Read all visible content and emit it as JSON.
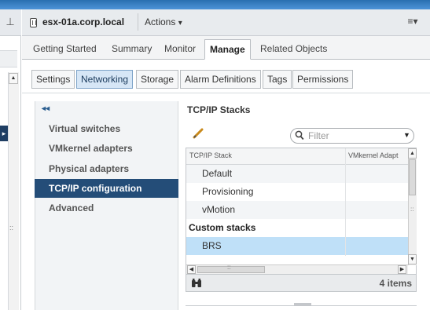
{
  "header": {
    "host_name": "esx-01a.corp.local",
    "actions_label": "Actions",
    "actions_caret": "▾",
    "menu_glyph": "≡▾",
    "pin_glyph": "⊥"
  },
  "main_tabs": [
    {
      "label": "Getting Started",
      "active": false
    },
    {
      "label": "Summary",
      "active": false
    },
    {
      "label": "Monitor",
      "active": false
    },
    {
      "label": "Manage",
      "active": true
    },
    {
      "label": "Related Objects",
      "active": false
    }
  ],
  "sub_tabs": [
    {
      "label": "Settings",
      "active": false
    },
    {
      "label": "Networking",
      "active": true
    },
    {
      "label": "Storage",
      "active": false
    },
    {
      "label": "Alarm Definitions",
      "active": false
    },
    {
      "label": "Tags",
      "active": false
    },
    {
      "label": "Permissions",
      "active": false
    }
  ],
  "left_nav": {
    "collapse_glyph": "◂◂",
    "items": [
      {
        "label": "Virtual switches",
        "selected": false
      },
      {
        "label": "VMkernel adapters",
        "selected": false
      },
      {
        "label": "Physical adapters",
        "selected": false
      },
      {
        "label": "TCP/IP configuration",
        "selected": true
      },
      {
        "label": "Advanced",
        "selected": false
      }
    ]
  },
  "panel": {
    "title": "TCP/IP Stacks",
    "filter_placeholder": "Filter",
    "columns": [
      "TCP/IP Stack",
      "VMkernel Adapt"
    ],
    "rows": [
      {
        "name": "Default",
        "type": "item",
        "style": "alt"
      },
      {
        "name": "Provisioning",
        "type": "item",
        "style": "plain"
      },
      {
        "name": "vMotion",
        "type": "item",
        "style": "alt"
      },
      {
        "name": "Custom stacks",
        "type": "group",
        "style": "plain"
      },
      {
        "name": "BRS",
        "type": "item",
        "style": "selected"
      }
    ],
    "item_count": "4 items"
  },
  "colors": {
    "selected_nav": "#244d78",
    "selected_row": "#bfe0f8",
    "top_bar": "#3a82c8"
  }
}
